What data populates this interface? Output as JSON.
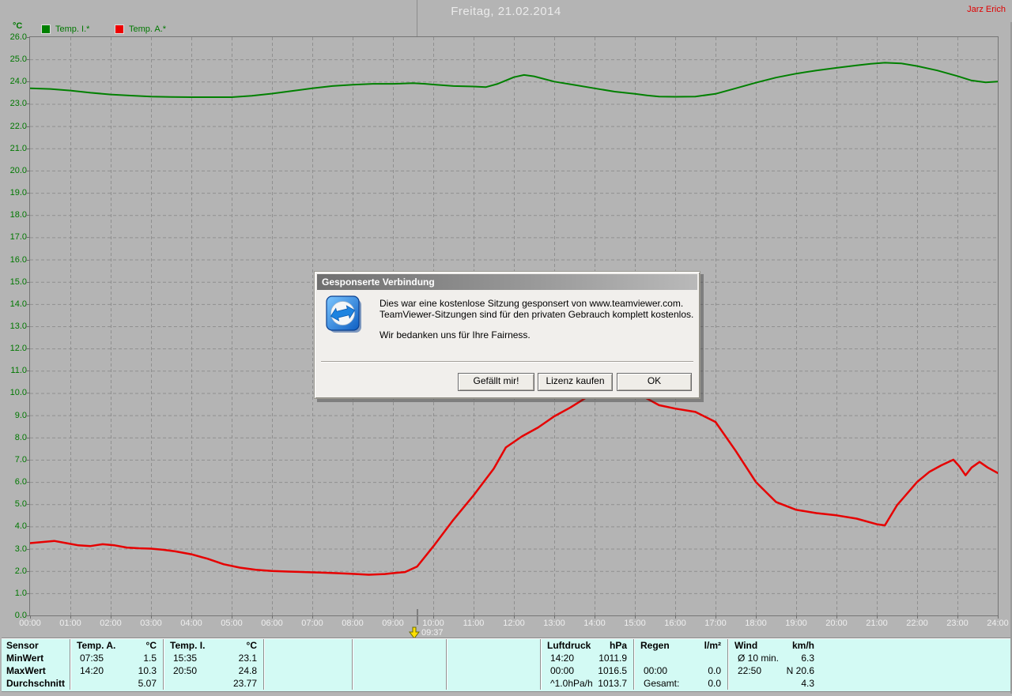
{
  "header": {
    "title": "Freitag, 21.02.2014",
    "user": "Jarz Erich"
  },
  "legend": {
    "unit": "°C",
    "series": [
      {
        "label": "Temp. I.*",
        "color": "#008000"
      },
      {
        "label": "Temp. A.*",
        "color": "#e60000"
      }
    ]
  },
  "cursor": {
    "time_label": "09:37",
    "hour": 9.62
  },
  "chart_data": {
    "type": "line",
    "title": "Freitag, 21.02.2014",
    "ylabel": "°C",
    "ylim": [
      0,
      26
    ],
    "xlim_hours": [
      0,
      24
    ],
    "grid": true,
    "y_tick_labels": [
      "0.0",
      "1.0",
      "2.0",
      "3.0",
      "4.0",
      "5.0",
      "6.0",
      "7.0",
      "8.0",
      "9.0",
      "10.0",
      "11.0",
      "12.0",
      "13.0",
      "14.0",
      "15.0",
      "16.0",
      "17.0",
      "18.0",
      "19.0",
      "20.0",
      "21.0",
      "22.0",
      "23.0",
      "24.0",
      "25.0",
      "26.0"
    ],
    "x_tick_labels": [
      "00:00",
      "01:00",
      "02:00",
      "03:00",
      "04:00",
      "05:00",
      "06:00",
      "07:00",
      "08:00",
      "09:00",
      "10:00",
      "11:00",
      "12:00",
      "13:00",
      "14:00",
      "15:00",
      "16:00",
      "17:00",
      "18:00",
      "19:00",
      "20:00",
      "21:00",
      "22:00",
      "23:00",
      "24:00"
    ],
    "series": [
      {
        "name": "Temp. I.*",
        "color": "#008000",
        "width": 2,
        "points": [
          [
            0,
            23.7
          ],
          [
            0.5,
            23.67
          ],
          [
            1,
            23.6
          ],
          [
            1.5,
            23.5
          ],
          [
            2,
            23.42
          ],
          [
            2.5,
            23.37
          ],
          [
            3,
            23.33
          ],
          [
            3.5,
            23.31
          ],
          [
            4,
            23.3
          ],
          [
            4.5,
            23.3
          ],
          [
            5,
            23.3
          ],
          [
            5.5,
            23.36
          ],
          [
            6,
            23.46
          ],
          [
            6.5,
            23.58
          ],
          [
            7,
            23.7
          ],
          [
            7.5,
            23.8
          ],
          [
            8,
            23.86
          ],
          [
            8.5,
            23.9
          ],
          [
            9,
            23.9
          ],
          [
            9.5,
            23.93
          ],
          [
            9.8,
            23.9
          ],
          [
            10,
            23.87
          ],
          [
            10.5,
            23.8
          ],
          [
            11,
            23.78
          ],
          [
            11.3,
            23.75
          ],
          [
            11.6,
            23.9
          ],
          [
            12,
            24.2
          ],
          [
            12.25,
            24.3
          ],
          [
            12.5,
            24.24
          ],
          [
            13,
            24.0
          ],
          [
            13.5,
            23.85
          ],
          [
            14,
            23.7
          ],
          [
            14.5,
            23.55
          ],
          [
            15,
            23.45
          ],
          [
            15.3,
            23.38
          ],
          [
            15.6,
            23.33
          ],
          [
            16,
            23.32
          ],
          [
            16.5,
            23.33
          ],
          [
            17,
            23.45
          ],
          [
            17.5,
            23.7
          ],
          [
            18,
            23.95
          ],
          [
            18.5,
            24.18
          ],
          [
            19,
            24.36
          ],
          [
            19.5,
            24.5
          ],
          [
            20,
            24.62
          ],
          [
            20.5,
            24.73
          ],
          [
            20.85,
            24.8
          ],
          [
            21.2,
            24.85
          ],
          [
            21.6,
            24.82
          ],
          [
            22,
            24.7
          ],
          [
            22.5,
            24.5
          ],
          [
            23,
            24.25
          ],
          [
            23.35,
            24.05
          ],
          [
            23.7,
            23.97
          ],
          [
            24,
            24.0
          ]
        ]
      },
      {
        "name": "Temp. A.*",
        "color": "#e60000",
        "width": 2.5,
        "points": [
          [
            0,
            3.25
          ],
          [
            0.3,
            3.3
          ],
          [
            0.6,
            3.35
          ],
          [
            0.9,
            3.25
          ],
          [
            1.2,
            3.15
          ],
          [
            1.5,
            3.12
          ],
          [
            1.8,
            3.2
          ],
          [
            2.1,
            3.15
          ],
          [
            2.4,
            3.05
          ],
          [
            2.7,
            3.02
          ],
          [
            3,
            3.0
          ],
          [
            3.3,
            2.95
          ],
          [
            3.6,
            2.88
          ],
          [
            4,
            2.75
          ],
          [
            4.4,
            2.55
          ],
          [
            4.8,
            2.3
          ],
          [
            5.2,
            2.15
          ],
          [
            5.6,
            2.05
          ],
          [
            6,
            2.0
          ],
          [
            6.4,
            1.97
          ],
          [
            6.8,
            1.95
          ],
          [
            7.2,
            1.93
          ],
          [
            7.6,
            1.9
          ],
          [
            8,
            1.87
          ],
          [
            8.4,
            1.83
          ],
          [
            8.8,
            1.86
          ],
          [
            9,
            1.9
          ],
          [
            9.3,
            1.95
          ],
          [
            9.6,
            2.2
          ],
          [
            10,
            3.1
          ],
          [
            10.5,
            4.3
          ],
          [
            11,
            5.4
          ],
          [
            11.5,
            6.6
          ],
          [
            11.8,
            7.55
          ],
          [
            12.2,
            8.05
          ],
          [
            12.6,
            8.45
          ],
          [
            13,
            8.95
          ],
          [
            13.4,
            9.35
          ],
          [
            13.8,
            9.8
          ],
          [
            14,
            10.0
          ],
          [
            14.33,
            10.3
          ],
          [
            14.7,
            10.2
          ],
          [
            15,
            10.05
          ],
          [
            15.25,
            9.8
          ],
          [
            15.6,
            9.45
          ],
          [
            16,
            9.3
          ],
          [
            16.5,
            9.15
          ],
          [
            17,
            8.7
          ],
          [
            17.5,
            7.4
          ],
          [
            18,
            6.0
          ],
          [
            18.5,
            5.1
          ],
          [
            19,
            4.75
          ],
          [
            19.5,
            4.6
          ],
          [
            20,
            4.5
          ],
          [
            20.5,
            4.35
          ],
          [
            21,
            4.1
          ],
          [
            21.2,
            4.05
          ],
          [
            21.5,
            4.95
          ],
          [
            22,
            6.0
          ],
          [
            22.3,
            6.45
          ],
          [
            22.6,
            6.75
          ],
          [
            22.9,
            7.0
          ],
          [
            23.05,
            6.7
          ],
          [
            23.2,
            6.3
          ],
          [
            23.35,
            6.65
          ],
          [
            23.55,
            6.9
          ],
          [
            23.75,
            6.65
          ],
          [
            24,
            6.4
          ]
        ]
      }
    ]
  },
  "dialog": {
    "title": "Gesponserte Verbindung",
    "lines": [
      "Dies war eine kostenlose Sitzung gesponsert von www.teamviewer.com.",
      "TeamViewer-Sitzungen sind für den privaten Gebrauch komplett kostenlos.",
      "Wir bedanken uns für Ihre Fairness."
    ],
    "buttons": [
      {
        "name": "like-button",
        "label": "Gefällt mir!"
      },
      {
        "name": "buy-license-button",
        "label": "Lizenz kaufen"
      },
      {
        "name": "ok-button",
        "label": "OK"
      }
    ]
  },
  "table": {
    "row_labels": [
      "Sensor",
      "MinWert",
      "MaxWert",
      "Durchschnitt"
    ],
    "columns": [
      {
        "header": "Temp. A.",
        "unit": "°C",
        "rows": [
          [
            "07:35",
            "1.5"
          ],
          [
            "14:20",
            "10.3"
          ],
          [
            "",
            "5.07"
          ]
        ]
      },
      {
        "header": "Temp. I.",
        "unit": "°C",
        "rows": [
          [
            "15:35",
            "23.1"
          ],
          [
            "20:50",
            "24.8"
          ],
          [
            "",
            "23.77"
          ]
        ]
      },
      {
        "header": "",
        "unit": "",
        "rows": [
          [
            "",
            ""
          ],
          [
            "",
            ""
          ],
          [
            "",
            ""
          ]
        ]
      },
      {
        "header": "",
        "unit": "",
        "rows": [
          [
            "",
            ""
          ],
          [
            "",
            ""
          ],
          [
            "",
            ""
          ]
        ]
      },
      {
        "header": "",
        "unit": "",
        "rows": [
          [
            "",
            ""
          ],
          [
            "",
            ""
          ],
          [
            "",
            ""
          ]
        ]
      },
      {
        "header": "Luftdruck",
        "unit": "hPa",
        "rows": [
          [
            "14:20",
            "1011.9"
          ],
          [
            "00:00",
            "1016.5"
          ],
          [
            "^1.0hPa/h",
            "1013.7"
          ]
        ]
      },
      {
        "header": "Regen",
        "unit": "l/m²",
        "rows": [
          [
            "",
            ""
          ],
          [
            "00:00",
            "0.0"
          ],
          [
            "Gesamt:",
            "0.0"
          ]
        ]
      },
      {
        "header": "Wind",
        "unit": "km/h",
        "rows": [
          [
            "Ø 10 min.",
            "6.3"
          ],
          [
            "22:50",
            "N 20.6"
          ],
          [
            "",
            "4.3"
          ]
        ]
      }
    ]
  }
}
